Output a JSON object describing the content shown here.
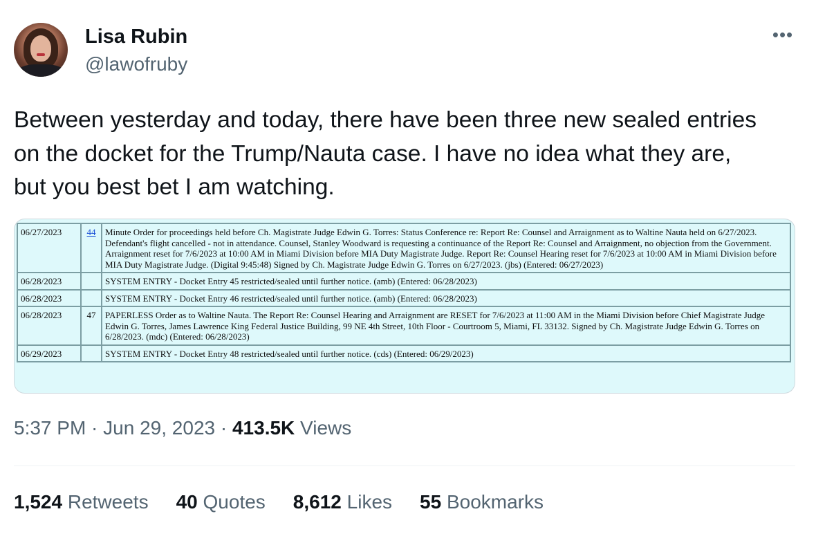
{
  "author": {
    "name": "Lisa Rubin",
    "handle": "@lawofruby"
  },
  "more_label": "•••",
  "tweet": {
    "lines": [
      "Between yesterday and today, there have been three new sealed entries",
      "on the docket for the Trump/Nauta case. I have no idea what they are,",
      "but you best bet I am watching."
    ]
  },
  "docket": [
    {
      "date": "06/27/2023",
      "num": "44",
      "text": "Minute Order for proceedings held before Ch. Magistrate Judge Edwin G. Torres: Status Conference re: Report Re: Counsel and Arraignment as to Waltine Nauta held on 6/27/2023. Defendant's flight cancelled - not in attendance. Counsel, Stanley Woodward is requesting a continuance of the Report Re: Counsel and Arraignment, no objection from the Government. Arraignment reset for 7/6/2023 at 10:00 AM in Miami Division before MIA Duty Magistrate Judge. Report Re: Counsel Hearing reset for 7/6/2023 at 10:00 AM in Miami Division before MIA Duty Magistrate Judge. (Digital 9:45:48) Signed by Ch. Magistrate Judge Edwin G. Torres on 6/27/2023. (jbs) (Entered: 06/27/2023)"
    },
    {
      "date": "06/28/2023",
      "num": "",
      "text": "SYSTEM ENTRY - Docket Entry 45 restricted/sealed until further notice. (amb) (Entered: 06/28/2023)"
    },
    {
      "date": "06/28/2023",
      "num": "",
      "text": "SYSTEM ENTRY - Docket Entry 46 restricted/sealed until further notice. (amb) (Entered: 06/28/2023)"
    },
    {
      "date": "06/28/2023",
      "num": "47",
      "text": "PAPERLESS Order as to Waltine Nauta. The Report Re: Counsel Hearing and Arraignment are RESET for 7/6/2023 at 11:00 AM in the Miami Division before Chief Magistrate Judge Edwin G. Torres, James Lawrence King Federal Justice Building, 99 NE 4th Street, 10th Floor - Courtroom 5, Miami, FL 33132. Signed by Ch. Magistrate Judge Edwin G. Torres on 6/28/2023. (mdc) (Entered: 06/28/2023)"
    },
    {
      "date": "06/29/2023",
      "num": "",
      "text": "SYSTEM ENTRY - Docket Entry 48 restricted/sealed until further notice. (cds) (Entered: 06/29/2023)"
    }
  ],
  "meta": {
    "time": "5:37 PM",
    "sep1": " · ",
    "date": "Jun 29, 2023",
    "sep2": " · ",
    "views_count": "413.5K",
    "views_label": " Views"
  },
  "stats": {
    "retweets_count": "1,524",
    "retweets_label": " Retweets",
    "quotes_count": "40",
    "quotes_label": " Quotes",
    "likes_count": "8,612",
    "likes_label": " Likes",
    "bookmarks_count": "55",
    "bookmarks_label": " Bookmarks"
  },
  "colors": {
    "text": "#0f1419",
    "secondary": "#536471",
    "docket_bg": "#def9fb",
    "link": "#1a4fd6"
  }
}
